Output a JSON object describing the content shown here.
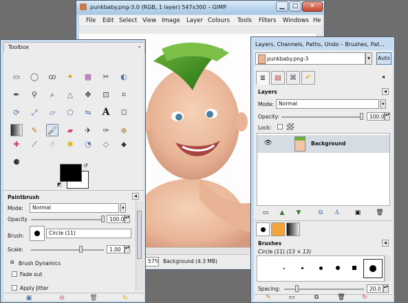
{
  "gimp_window": {
    "title": "punkbaby.png-3.0 (RGB, 1 layer) 547x300 – GIMP",
    "menu": [
      "File",
      "Edit",
      "Select",
      "View",
      "Image",
      "Layer",
      "Colours",
      "Tools",
      "Filters",
      "Windows",
      "He"
    ],
    "status_zoom": "57%",
    "status_text": "Background (4.3 MB)"
  },
  "toolbox": {
    "title": "Toolbox",
    "tool_icons": [
      "rect-select",
      "ellipse-select",
      "free-select",
      "fuzzy-select",
      "select-by-color",
      "scissors",
      "foreground-select",
      "paths",
      "color-picker",
      "zoom",
      "measure",
      "move",
      "align",
      "crop",
      "rotate",
      "scale",
      "shear",
      "perspective",
      "flip",
      "text",
      "bucket-fill",
      "blend",
      "pencil",
      "paintbrush",
      "eraser",
      "airbrush",
      "ink",
      "clone",
      "heal",
      "perspective-clone",
      "smudge",
      "blur",
      "dodge-burn",
      "desaturate"
    ],
    "options": {
      "heading": "Paintbrush",
      "mode_label": "Mode:",
      "mode_value": "Normal",
      "opacity_label": "Opacity",
      "opacity_value": "100.0",
      "opacity_fraction": 1.0,
      "brush_label": "Brush:",
      "brush_value": "Circle (11)",
      "scale_label": "Scale:",
      "scale_value": "1.00",
      "brush_dynamics_label": "Brush Dynamics",
      "fade_out_label": "Fade out",
      "apply_jitter_label": "Apply Jitter"
    }
  },
  "layers_dock": {
    "title": "Layers, Channels, Paths, Undo – Brushes, Pat...",
    "image_selector": "punkbaby.png-3",
    "auto_label": "Auto",
    "layers_heading": "Layers",
    "mode_label": "Mode:",
    "mode_value": "Normal",
    "opacity_label": "Opacity:",
    "opacity_value": "100.0",
    "lock_label": "Lock:",
    "layer_name": "Background",
    "brushes_heading": "Brushes",
    "brush_info": "Circle (11) (13 × 13)",
    "spacing_label": "Spacing:",
    "spacing_value": "20.0"
  }
}
